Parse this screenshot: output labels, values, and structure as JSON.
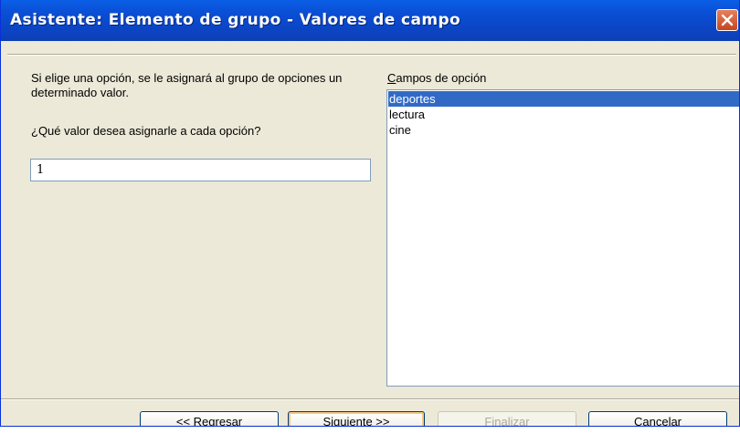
{
  "window": {
    "title": "Asistente: Elemento de grupo - Valores de campo",
    "close_icon": "close-icon"
  },
  "left": {
    "description": "Si elige una opción, se le asignará al grupo de opciones un determinado valor.",
    "question": "¿Qué valor desea asignarle a cada opción?",
    "value": "1"
  },
  "right": {
    "label_accel": "C",
    "label_rest": "ampos de opción",
    "items": [
      "deportes",
      "lectura",
      "cine"
    ],
    "selected_index": 0
  },
  "buttons": {
    "back": {
      "prefix": "<< ",
      "accel": "R",
      "rest": "egresar"
    },
    "next": {
      "prefix": "",
      "accel": "S",
      "rest": "iguiente >>"
    },
    "finish": {
      "prefix": "",
      "accel": "F",
      "rest": "inalizar",
      "disabled": true
    },
    "cancel": {
      "label": "Cancelar"
    }
  },
  "colors": {
    "titlebar": "#0a4fd6",
    "selection": "#316ac5",
    "dialog_bg": "#ece9d8"
  }
}
